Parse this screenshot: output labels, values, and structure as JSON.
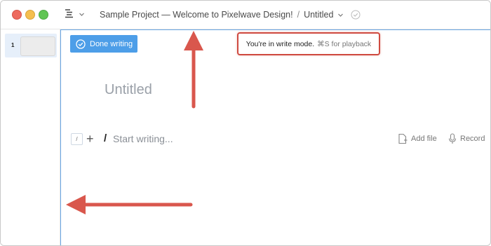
{
  "window": {
    "breadcrumb_project": "Sample Project — Welcome to Pixelwave Design!",
    "breadcrumb_separator": "/",
    "breadcrumb_doc": "Untitled"
  },
  "sidebar": {
    "slides": [
      {
        "number": "1"
      }
    ]
  },
  "editor": {
    "done_label": "Done writing",
    "mode_text": "You're in write mode.",
    "mode_hint": "⌘S for playback",
    "title": "Untitled",
    "slash_chip": "/",
    "plus": "+",
    "slash_mark": "/",
    "placeholder": "Start writing...",
    "add_file_label": "Add file",
    "record_label": "Record"
  },
  "colors": {
    "accent": "#4d9ee8",
    "annotation": "#cf4a40",
    "selection": "#e6effa"
  },
  "icons": [
    "doc-menu-icon",
    "chevron-down-icon",
    "saved-check-icon",
    "check-circle-icon",
    "add-file-icon",
    "microphone-icon"
  ]
}
